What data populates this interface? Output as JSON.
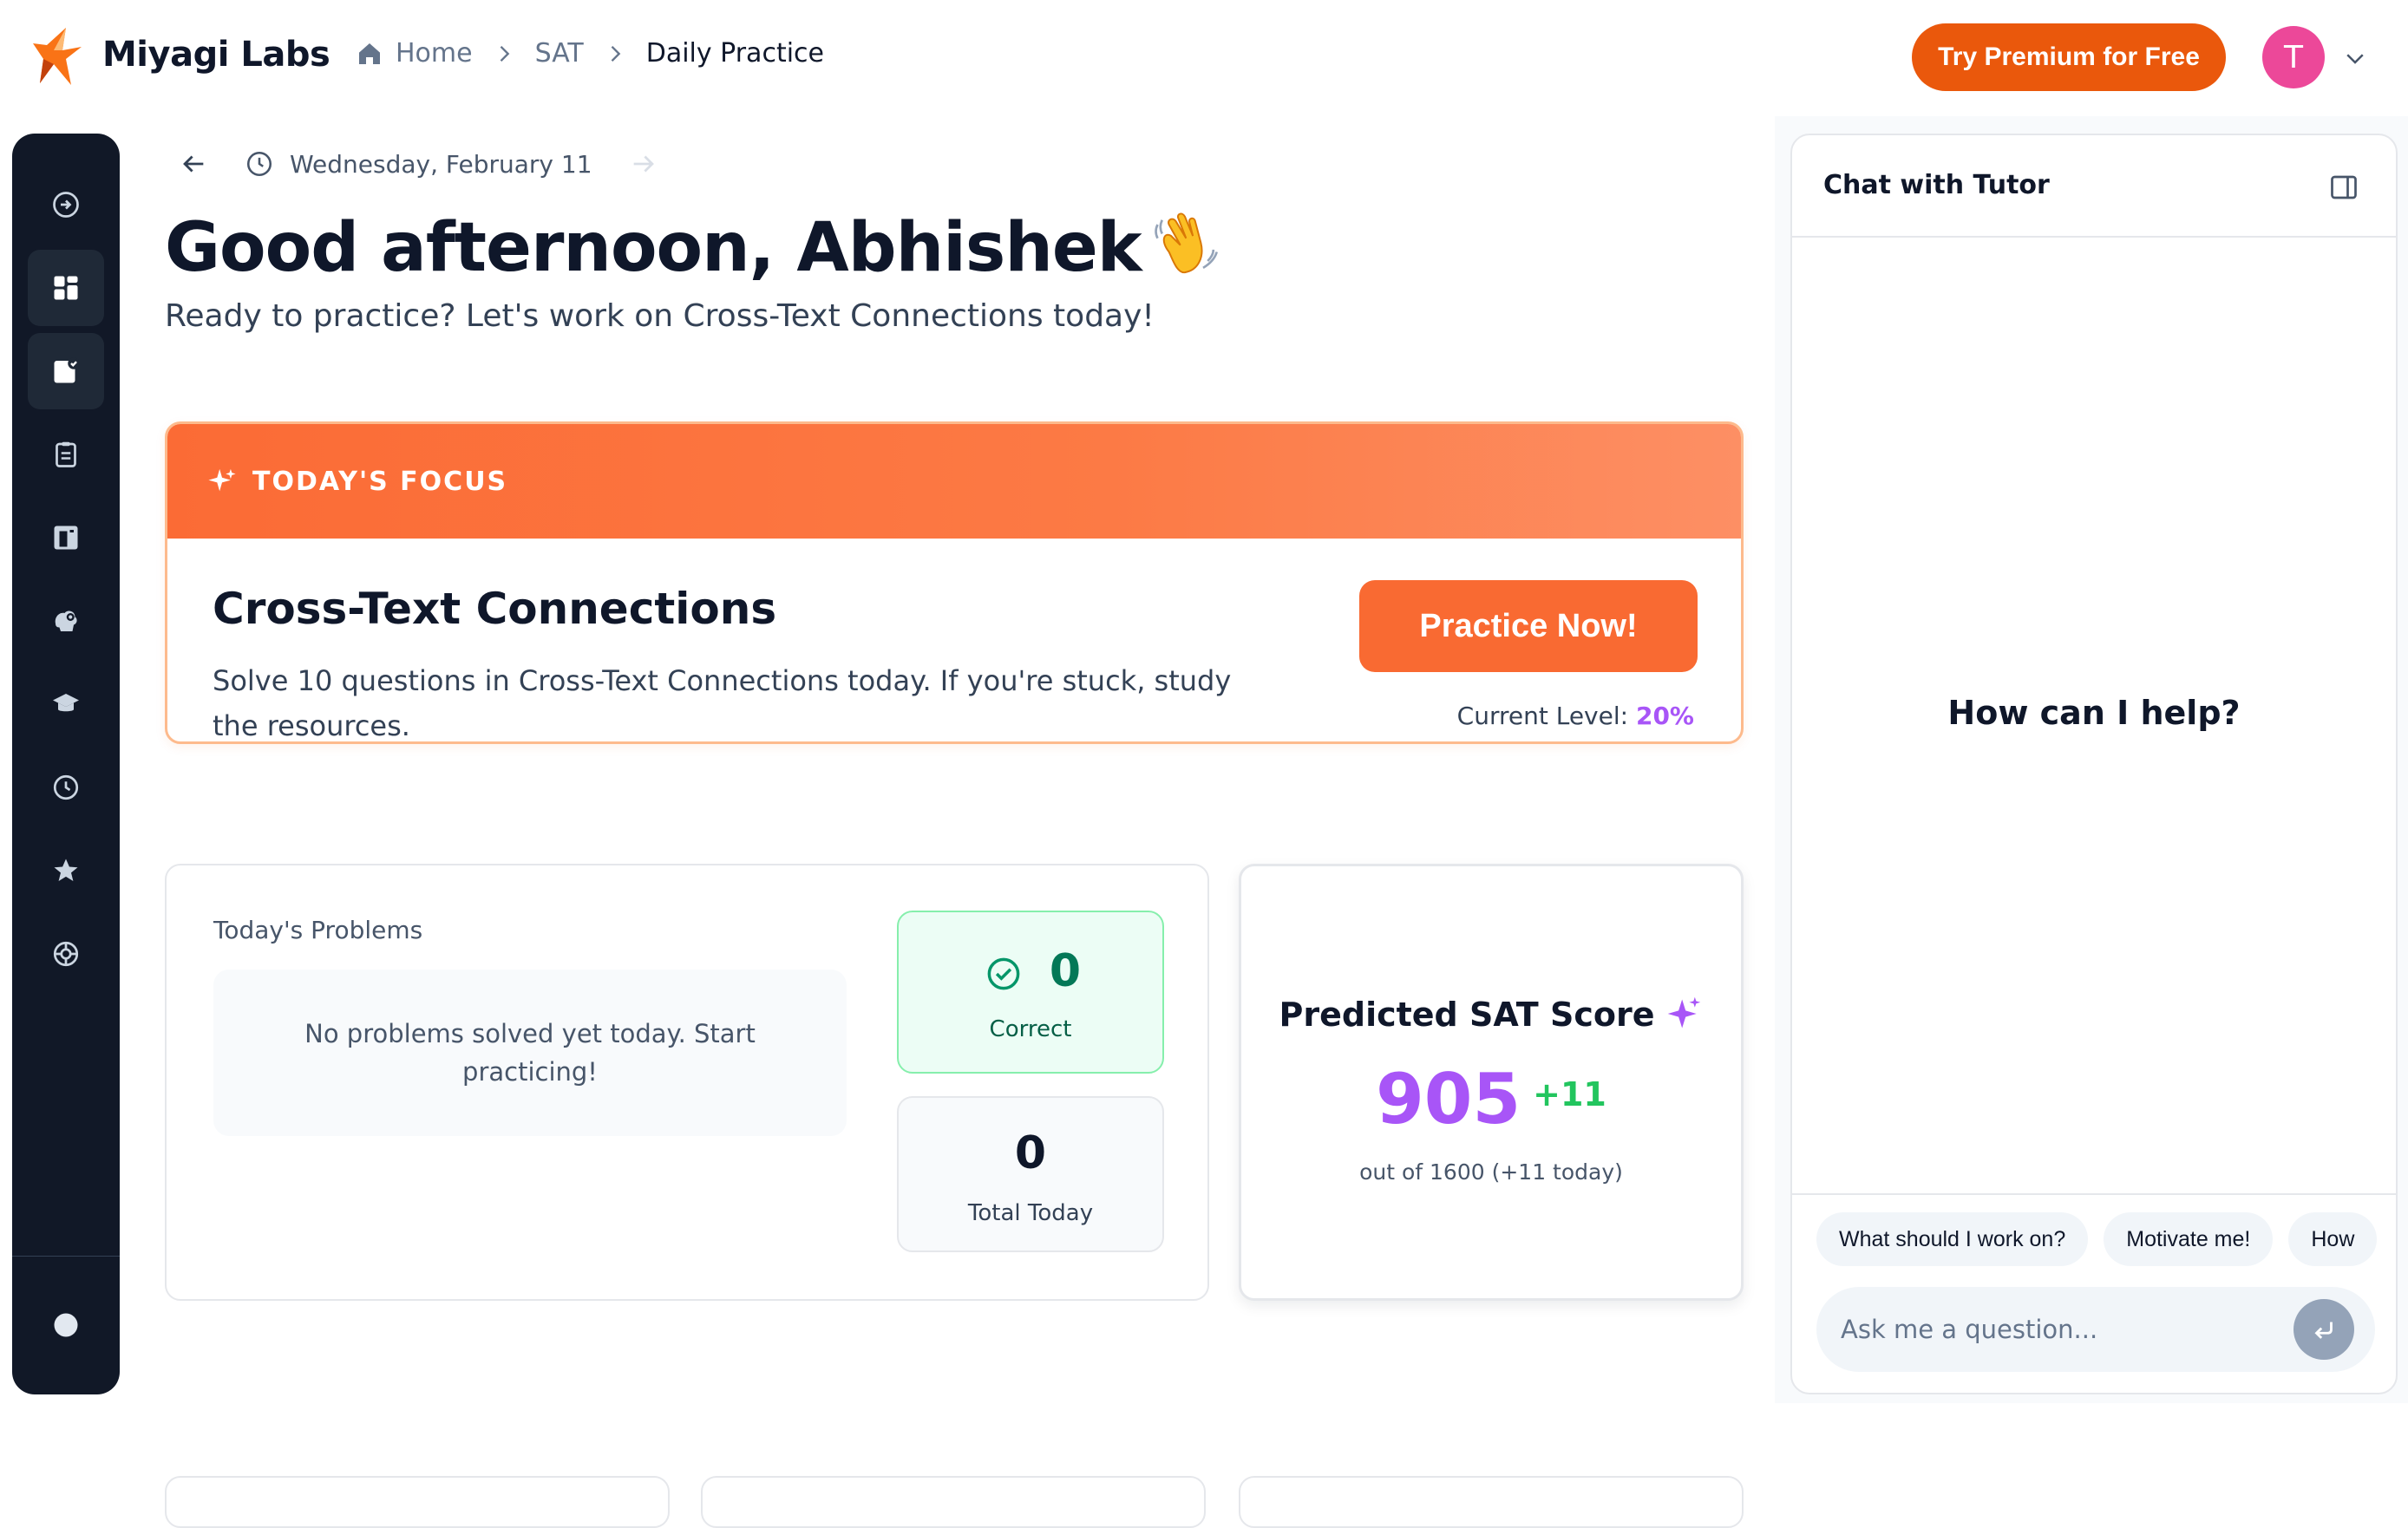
{
  "app": {
    "name": "Miyagi Labs"
  },
  "breadcrumb": {
    "home": "Home",
    "section": "SAT",
    "current": "Daily Practice"
  },
  "header": {
    "premium_label": "Try Premium for Free",
    "avatar_initial": "T"
  },
  "colors": {
    "accent": "#ea580c",
    "focus": "#f96a32",
    "purple": "#a855f7",
    "green": "#22c55e",
    "sidebar": "#111827"
  },
  "sidebar": {
    "items": [
      {
        "icon": "expand-icon"
      },
      {
        "icon": "dashboard-icon",
        "active": true
      },
      {
        "icon": "daily-practice-icon",
        "active": true
      },
      {
        "icon": "clipboard-icon"
      },
      {
        "icon": "book-icon"
      },
      {
        "icon": "brain-icon"
      },
      {
        "icon": "graduation-cap-icon"
      },
      {
        "icon": "clock-icon"
      },
      {
        "icon": "star-icon"
      },
      {
        "icon": "lifebuoy-icon"
      },
      {
        "icon": "theme-toggle-icon"
      }
    ]
  },
  "main": {
    "date": "Wednesday, February 11",
    "greeting": "Good afternoon, Abhishek",
    "subgreeting": "Ready to practice? Let's work on Cross-Text Connections today!",
    "focus": {
      "header": "TODAY'S FOCUS",
      "title": "Cross-Text Connections",
      "description": "Solve 10 questions in Cross-Text Connections today. If you're stuck, study the resources.",
      "button": "Practice Now!",
      "level_label": "Current Level:",
      "level_value": "20%"
    },
    "problems": {
      "label": "Today's Problems",
      "empty": "No problems solved yet today. Start practicing!",
      "correct_value": "0",
      "correct_label": "Correct",
      "total_value": "0",
      "total_label": "Total Today"
    },
    "sat": {
      "title": "Predicted SAT Score",
      "score": "905",
      "delta": "+11",
      "sub": "out of 1600 (+11 today)"
    }
  },
  "chat": {
    "title": "Chat with Tutor",
    "help": "How can I help?",
    "chips": [
      "What should I work on?",
      "Motivate me!",
      "How"
    ],
    "placeholder": "Ask me a question..."
  }
}
